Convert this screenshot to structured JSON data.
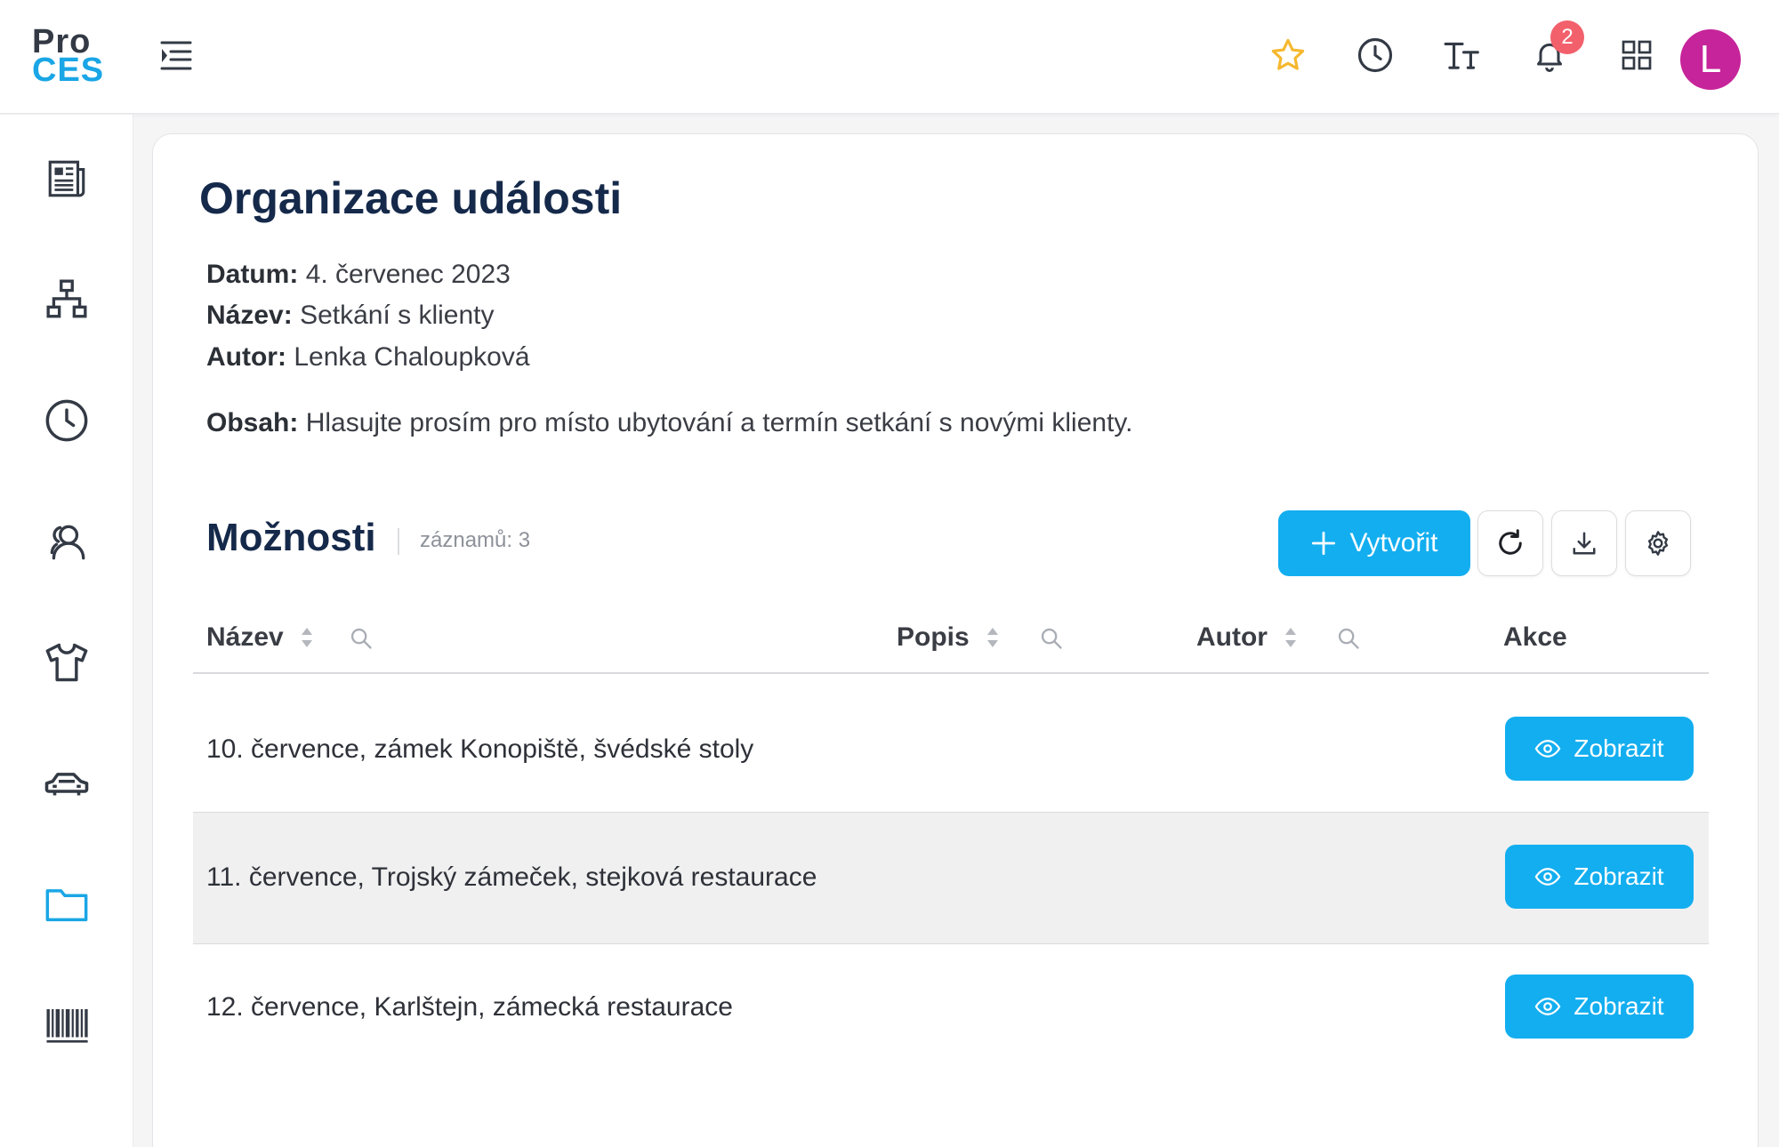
{
  "app": {
    "logo_line1": "Pro",
    "logo_line2": "CES"
  },
  "header": {
    "notification_count": "2",
    "avatar_initial": "L",
    "colors": {
      "star": "#f5b82e",
      "avatar": "#c6249a",
      "badge": "#f2606c"
    }
  },
  "sidebar": {
    "items": [
      {
        "icon": "newspaper-icon"
      },
      {
        "icon": "org-chart-icon"
      },
      {
        "icon": "clock-icon"
      },
      {
        "icon": "users-icon"
      },
      {
        "icon": "tshirt-icon"
      },
      {
        "icon": "car-icon"
      },
      {
        "icon": "folder-icon",
        "active": true
      },
      {
        "icon": "barcode-icon"
      }
    ]
  },
  "event": {
    "title": "Organizace události",
    "date_label": "Datum:",
    "date_value": "4. červenec 2023",
    "name_label": "Název:",
    "name_value": "Setkání s klienty",
    "author_label": "Autor:",
    "author_value": "Lenka Chaloupková",
    "content_label": "Obsah:",
    "content_value": "Hlasujte prosím pro místo ubytování a termín setkání s novými klienty."
  },
  "options": {
    "title": "Možnosti",
    "record_count": "záznamů: 3",
    "create_label": "Vytvořit",
    "columns": {
      "name": "Název",
      "description": "Popis",
      "author": "Autor",
      "actions": "Akce"
    },
    "rows": [
      {
        "name": "10. července, zámek Konopiště, švédské stoly",
        "action": "Zobrazit"
      },
      {
        "name": "11. července, Trojský zámeček, stejková restaurace",
        "action": "Zobrazit"
      },
      {
        "name": "12. července, Karlštejn, zámecká restaurace",
        "action": "Zobrazit"
      }
    ],
    "accent_color": "#13aef0"
  }
}
